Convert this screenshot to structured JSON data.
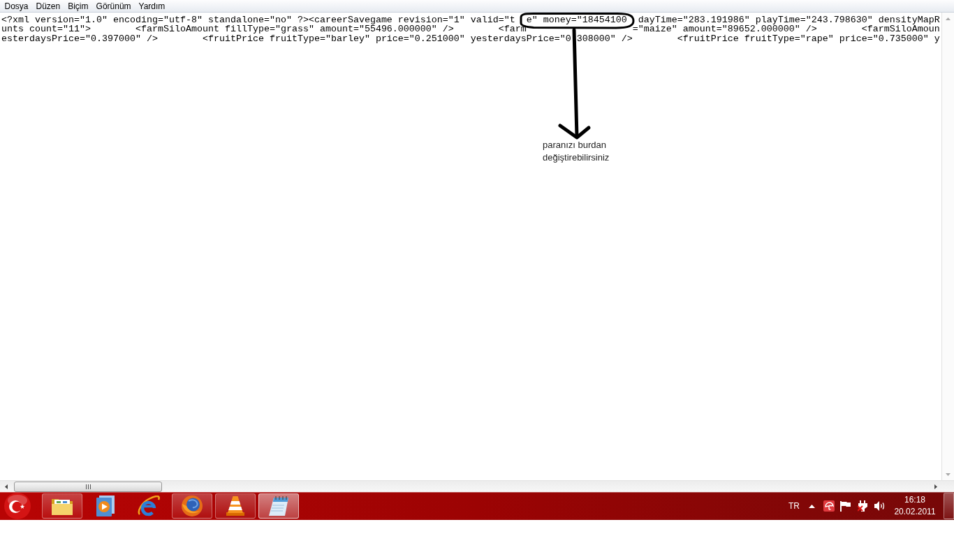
{
  "menu_bar": {
    "items": [
      "Dosya",
      "Düzen",
      "Biçim",
      "Görünüm",
      "Yardım"
    ]
  },
  "editor": {
    "lines": [
      {
        "segments": [
          "<?xml version=\"1.0\" encoding=\"utf-8\" standalone=\"no\" ?><careerSavegame revision=\"1\" valid=\"t",
          "e\" money=\"18454100",
          "dayTime=\"283.191986\" playTime=\"243.798630\" densityMapR"
        ]
      },
      {
        "segments": [
          "unts count=\"11\">        <farmSiloAmount fillType=\"grass\" amount=\"55496.000000\" />        <farm",
          "=\"maize\" amount=\"89652.000000\" />        <farmSiloAmoun"
        ]
      },
      {
        "segments": [
          "esterdaysPrice=\"0.397000\" />        <fruitPrice fruitType=\"barley\" price=\"0.251000\" yesterdaysPrice=\"0",
          "308000\" />        <fruitPrice fruitType=\"rape\" price=\"0.735000\" y"
        ]
      }
    ]
  },
  "annotation": {
    "note": "paranızı burdan değiştirebilirsiniz"
  },
  "taskbar": {
    "buttons": [
      {
        "kind": "folder",
        "running": true,
        "selected": false
      },
      {
        "kind": "player",
        "running": false,
        "selected": false
      },
      {
        "kind": "ebrowser",
        "running": false,
        "selected": false
      },
      {
        "kind": "globe",
        "running": true,
        "selected": false
      },
      {
        "kind": "cone",
        "running": true,
        "selected": false
      },
      {
        "kind": "notepad",
        "running": true,
        "selected": true
      }
    ]
  },
  "tray": {
    "language": "TR",
    "time": "16:18",
    "date": "20.02.2011"
  }
}
